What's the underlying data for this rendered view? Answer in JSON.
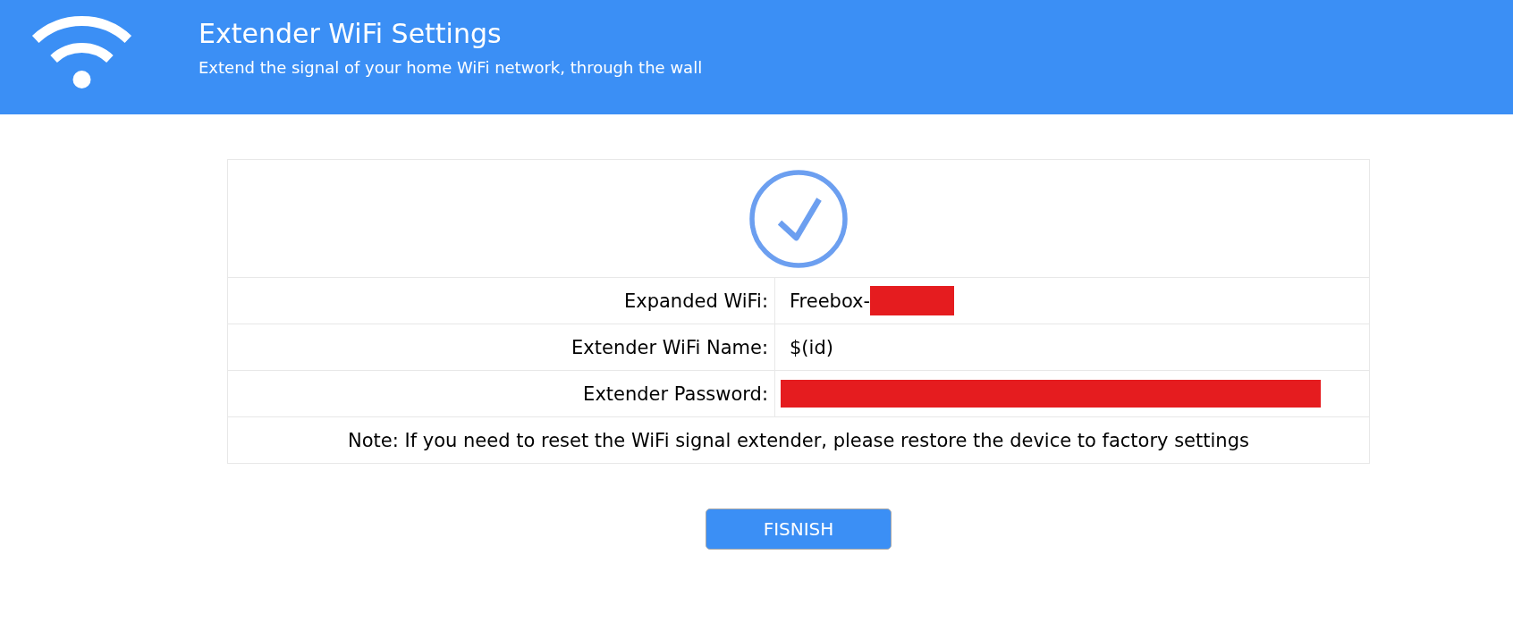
{
  "header": {
    "title": "Extender WiFi Settings",
    "subtitle": "Extend the signal of your home WiFi network, through the wall"
  },
  "result": {
    "success": true,
    "rows": [
      {
        "label": "Expanded WiFi:",
        "value": "Freebox-",
        "redacted": true
      },
      {
        "label": "Extender WiFi Name:",
        "value": "$(id)"
      },
      {
        "label": "Extender Password:",
        "redacted": true
      }
    ],
    "note": "Note: If you need to reset the WiFi signal extender, please restore the device to factory settings"
  },
  "button": {
    "label": "FISNISH"
  }
}
